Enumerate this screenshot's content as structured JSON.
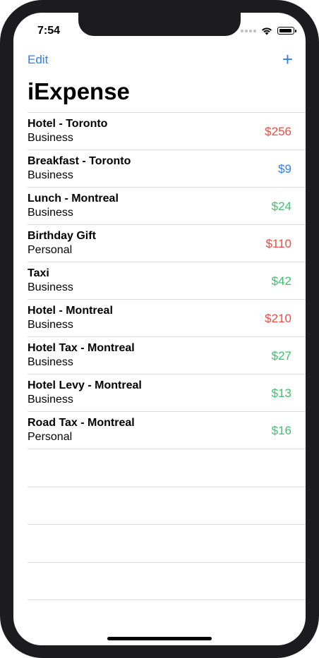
{
  "status": {
    "time": "7:54"
  },
  "nav": {
    "edit_label": "Edit",
    "add_label": "+"
  },
  "title": "iExpense",
  "colors": {
    "accent": "#2f7cf6",
    "red": "#ef4b3f",
    "green": "#3ec16b",
    "blue": "#2f7cf6"
  },
  "expenses": [
    {
      "name": "Hotel - Toronto",
      "type": "Business",
      "amount": "$256",
      "color": "#ef4b3f"
    },
    {
      "name": "Breakfast - Toronto",
      "type": "Business",
      "amount": "$9",
      "color": "#2f7cf6"
    },
    {
      "name": "Lunch - Montreal",
      "type": "Business",
      "amount": "$24",
      "color": "#3ec16b"
    },
    {
      "name": "Birthday Gift",
      "type": "Personal",
      "amount": "$110",
      "color": "#ef4b3f"
    },
    {
      "name": "Taxi",
      "type": "Business",
      "amount": "$42",
      "color": "#3ec16b"
    },
    {
      "name": "Hotel - Montreal",
      "type": "Business",
      "amount": "$210",
      "color": "#ef4b3f"
    },
    {
      "name": "Hotel Tax - Montreal",
      "type": "Business",
      "amount": "$27",
      "color": "#3ec16b"
    },
    {
      "name": "Hotel Levy - Montreal",
      "type": "Business",
      "amount": "$13",
      "color": "#3ec16b"
    },
    {
      "name": "Road Tax - Montreal",
      "type": "Personal",
      "amount": "$16",
      "color": "#3ec16b"
    }
  ]
}
